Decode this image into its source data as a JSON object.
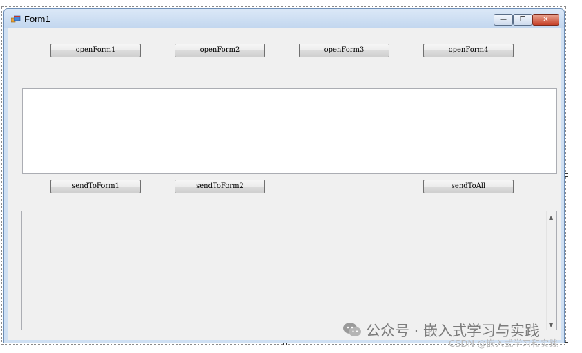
{
  "window": {
    "title": "Form1",
    "controls": {
      "minimize": "—",
      "maximize": "❐",
      "close": "✕"
    }
  },
  "open_buttons": [
    "openForm1",
    "openForm2",
    "openForm3",
    "openForm4"
  ],
  "send_buttons": {
    "form1": "sendToForm1",
    "form2": "sendToForm2",
    "all": "sendToAll"
  },
  "textbox": {
    "value": ""
  },
  "listbox": {
    "items": []
  },
  "watermark": {
    "text": "公众号 · 嵌入式学习与实践",
    "credit": "CSDN @嵌入式学习和实践"
  },
  "colors": {
    "titlebar": "#c3d7ef",
    "client": "#f0f0f0",
    "close": "#c7432b"
  }
}
